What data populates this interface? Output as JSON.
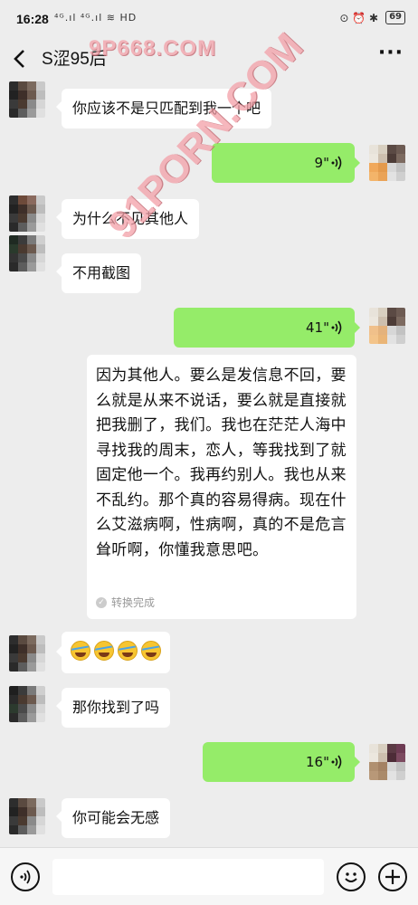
{
  "status_bar": {
    "time": "16:28",
    "left_indicators": "⁴ᴳ.ıl ⁴ᴳ.ıl ≋ HD",
    "right_indicators": "⊙ ⏰ ✱",
    "battery": "69"
  },
  "header": {
    "title": "S涩95后",
    "back_icon": "chevron-left-icon",
    "more_label": "···"
  },
  "watermarks": {
    "top": "9P668.COM",
    "diagonal": "91PORN.COM"
  },
  "messages": [
    {
      "side": "in",
      "type": "text",
      "text": "你应该不是只匹配到我一个吧"
    },
    {
      "side": "out",
      "type": "voice",
      "duration": "9\""
    },
    {
      "side": "in",
      "type": "text",
      "text": "为什么不见其他人"
    },
    {
      "side": "in",
      "type": "text",
      "text": "不用截图"
    },
    {
      "side": "out",
      "type": "voice",
      "duration": "41\""
    },
    {
      "side": "out",
      "type": "transcript",
      "text": "因为其他人。要么是发信息不回，要么就是从来不说话，要么就是直接就把我删了，我们。我也在茫茫人海中寻找我的周末，恋人，等我找到了就固定他一个。我再约别人。我也从来不乱约。那个真的容易得病。现在什么艾滋病啊，性病啊，真的不是危言耸听啊，你懂我意思吧。",
      "status": "转换完成"
    },
    {
      "side": "in",
      "type": "emoji",
      "count": 4,
      "emoji": "rolling-laughing-emoji"
    },
    {
      "side": "in",
      "type": "text",
      "text": "那你找到了吗"
    },
    {
      "side": "out",
      "type": "voice",
      "duration": "16\""
    },
    {
      "side": "in",
      "type": "text",
      "text": "你可能会无感"
    }
  ],
  "input_bar": {
    "voice_icon": "voice-mode-icon",
    "emoji_icon": "smiley-icon",
    "plus_icon": "plus-icon",
    "placeholder": ""
  },
  "colors": {
    "background": "#ededed",
    "incoming_bubble": "#ffffff",
    "outgoing_bubble": "#95ec69",
    "watermark": "#f3a0a8"
  }
}
